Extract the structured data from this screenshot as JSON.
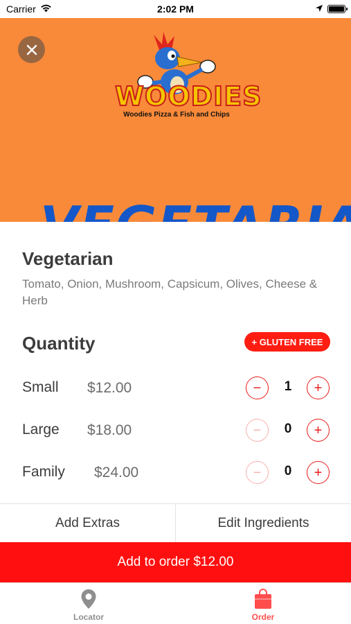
{
  "status_bar": {
    "carrier": "Carrier",
    "time": "2:02 PM",
    "wifi_icon": "wifi-icon",
    "location_icon": "location-arrow-icon",
    "battery_icon": "battery-icon"
  },
  "hero": {
    "close_icon": "close-icon",
    "logo_wordmark": "WOODIES",
    "logo_tagline": "Woodies Pizza & Fish and Chips",
    "banner_text": "VEGETARIAN",
    "background_color": "#f98a3a"
  },
  "item": {
    "title": "Vegetarian",
    "description": "Tomato, Onion, Mushroom, Capsicum, Olives, Cheese & Herb"
  },
  "quantity": {
    "title": "Quantity",
    "gluten_free_label": "+ GLUTEN FREE",
    "sizes": [
      {
        "name": "Small",
        "price": "$12.00",
        "count": "1",
        "minus_enabled": true
      },
      {
        "name": "Large",
        "price": "$18.00",
        "count": "0",
        "minus_enabled": false
      },
      {
        "name": "Family",
        "price": "$24.00",
        "count": "0",
        "minus_enabled": false
      }
    ],
    "minus_symbol": "−",
    "plus_symbol": "+"
  },
  "actions": {
    "add_extras": "Add Extras",
    "edit_ingredients": "Edit Ingredients"
  },
  "order_button": {
    "label": "Add to order $12.00",
    "color": "#ff0f0f"
  },
  "tab_bar": {
    "tabs": [
      {
        "label": "Locator",
        "icon": "map-pin-icon",
        "active": false
      },
      {
        "label": "Order",
        "icon": "shopping-bag-icon",
        "active": true
      }
    ],
    "active_color": "#ff4d4d",
    "inactive_color": "#8e8e8e"
  },
  "colors": {
    "accent": "#e81b1b",
    "accent_disabled": "#f6b0ad"
  }
}
